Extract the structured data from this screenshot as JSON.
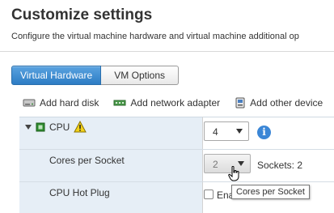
{
  "header": {
    "title": "Customize settings",
    "subtitle": "Configure the virtual machine hardware and virtual machine additional op"
  },
  "tabs": [
    {
      "label": "Virtual Hardware",
      "active": true
    },
    {
      "label": "VM Options",
      "active": false
    }
  ],
  "toolbar": {
    "add_hard_disk": "Add hard disk",
    "add_network_adapter": "Add network adapter",
    "add_other_device": "Add other device"
  },
  "cpu": {
    "label": "CPU",
    "value": "4",
    "warning_icon": "warning-triangle-icon",
    "info_icon_text": "i"
  },
  "cores_per_socket": {
    "label": "Cores per Socket",
    "value": "2",
    "sockets_text": "Sockets: 2"
  },
  "hot_plug": {
    "label": "CPU Hot Plug",
    "checkbox_text": "Ena",
    "checked": false
  },
  "tooltip": {
    "text": "Cores per Socket"
  },
  "colors": {
    "accent": "#2d7cc4",
    "grid_left": "#e6eef6",
    "warning": "#f3d21a",
    "cpu_icon": "#2e8b2e"
  }
}
